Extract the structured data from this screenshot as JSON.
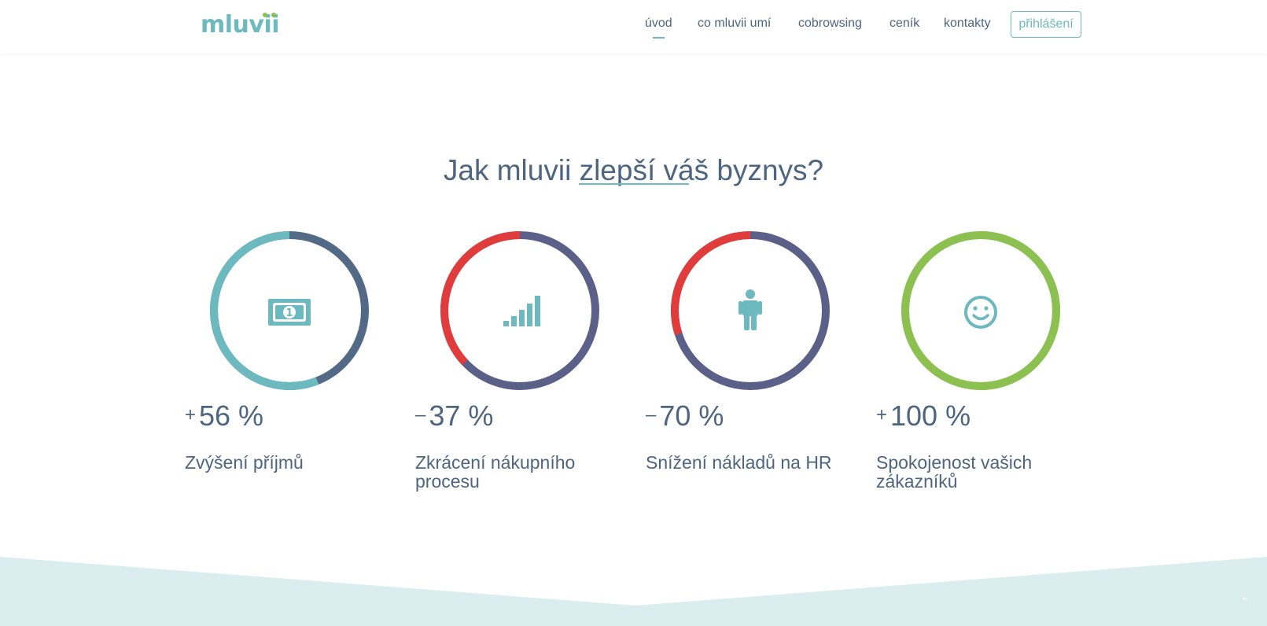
{
  "brand": {
    "logo_text": "mluvii",
    "primary": "#6cb9c0",
    "accent_green": "#8cc152",
    "text": "#4e6580"
  },
  "nav": {
    "items": [
      {
        "label": "úvod",
        "active": true
      },
      {
        "label": "co mluvii umí",
        "active": false
      },
      {
        "label": "cobrowsing",
        "active": false
      },
      {
        "label": "ceník",
        "active": false
      },
      {
        "label": "kontakty",
        "active": false
      }
    ],
    "login_label": "přihlášení"
  },
  "section": {
    "title": "Jak mluvii zlepší váš byznys?"
  },
  "stats": [
    {
      "sign": "+",
      "value": "56 %",
      "label": "Zvýšení příjmů",
      "icon": "money-icon",
      "ring_fraction": 0.56,
      "ring_color": "#6cb9c0",
      "base_color": "#526a86"
    },
    {
      "sign": "–",
      "value": "37 %",
      "label": "Zkrácení nákupního procesu",
      "icon": "signal-bars-icon",
      "ring_fraction": 0.37,
      "ring_color": "#e03c3c",
      "base_color": "#5b6088"
    },
    {
      "sign": "–",
      "value": "70 %",
      "label": "Snížení nákladů na HR",
      "icon": "person-icon",
      "ring_fraction": 0.3,
      "ring_color": "#e03c3c",
      "base_color": "#5b6088"
    },
    {
      "sign": "+",
      "value": "100 %",
      "label": "Spokojenost vašich zákazníků",
      "icon": "smiley-icon",
      "ring_fraction": 1.0,
      "ring_color": "#8cc152",
      "base_color": "#8cc152"
    }
  ],
  "scroll_top_icon": "chevron-up-icon"
}
